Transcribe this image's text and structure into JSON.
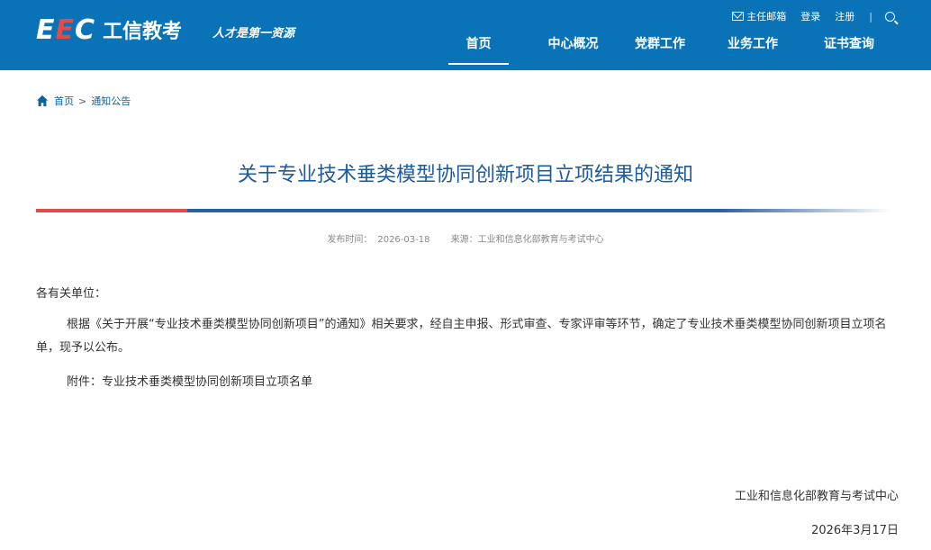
{
  "header": {
    "logo_mark_white1": "E",
    "logo_mark_red": "E",
    "logo_mark_white2": "C",
    "logo_text": "工信教考",
    "slogan": "人才是第一资源",
    "toplinks": {
      "mail": "主任邮箱",
      "login": "登录",
      "register": "注册",
      "separator": "|"
    },
    "nav": [
      "首页",
      "中心概况",
      "党群工作",
      "业务工作",
      "证书查询"
    ]
  },
  "breadcrumb": {
    "home": "首页",
    "separator": ">",
    "current": "通知公告"
  },
  "article": {
    "title": "关于专业技术垂类模型协同创新项目立项结果的通知",
    "publish_label": "发布时间：",
    "publish_date": "2026-03-18",
    "source_label": "来源：",
    "source": "工业和信息化部教育与考试中心",
    "greeting": "各有关单位：",
    "body": "根据《关于开展“专业技术垂类模型协同创新项目”的通知》相关要求，经自主申报、形式审查、专家评审等环节，确定了专业技术垂类模型协同创新项目立项名单，现予以公布。",
    "attachment": "附件：专业技术垂类模型协同创新项目立项名单",
    "signature": "工业和信息化部教育与考试中心",
    "sign_date": "2026年3月17日"
  },
  "colors": {
    "header_bg": "#0a72b6",
    "title": "#1d5a9e",
    "accent_red": "#e04b4b",
    "accent_blue": "#2d5fa0"
  }
}
